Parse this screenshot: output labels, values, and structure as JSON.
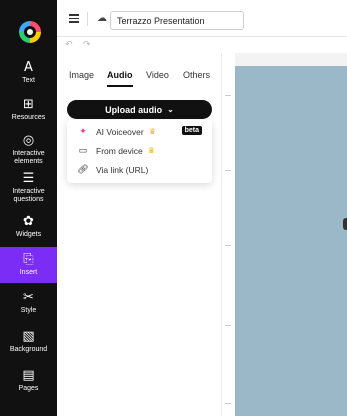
{
  "app": {
    "document_title": "Terrazzo Presentation"
  },
  "rail": {
    "items": [
      {
        "label": "Text",
        "icon": "text-icon"
      },
      {
        "label": "Resources",
        "icon": "resources-icon"
      },
      {
        "label": "Interactive\nelements",
        "icon": "interactive-elements-icon"
      },
      {
        "label": "Interactive\nquestions",
        "icon": "interactive-questions-icon"
      },
      {
        "label": "Widgets",
        "icon": "widgets-icon"
      },
      {
        "label": "Insert",
        "icon": "insert-icon",
        "active": true
      },
      {
        "label": "Style",
        "icon": "style-icon"
      },
      {
        "label": "Background",
        "icon": "background-icon"
      },
      {
        "label": "Pages",
        "icon": "pages-icon"
      }
    ],
    "active_color": "#7b2cf5"
  },
  "panel": {
    "tabs": [
      {
        "label": "Image"
      },
      {
        "label": "Audio",
        "active": true
      },
      {
        "label": "Video"
      },
      {
        "label": "Others"
      }
    ],
    "upload_button": "Upload audio",
    "dropdown": [
      {
        "label": "AI Voiceover",
        "icon": "sparkle-icon",
        "premium": true,
        "badge": "beta"
      },
      {
        "label": "From device",
        "icon": "laptop-icon",
        "premium": true
      },
      {
        "label": "Via link (URL)",
        "icon": "link-icon"
      }
    ]
  },
  "canvas": {
    "background_color": "#9ab8c8"
  }
}
